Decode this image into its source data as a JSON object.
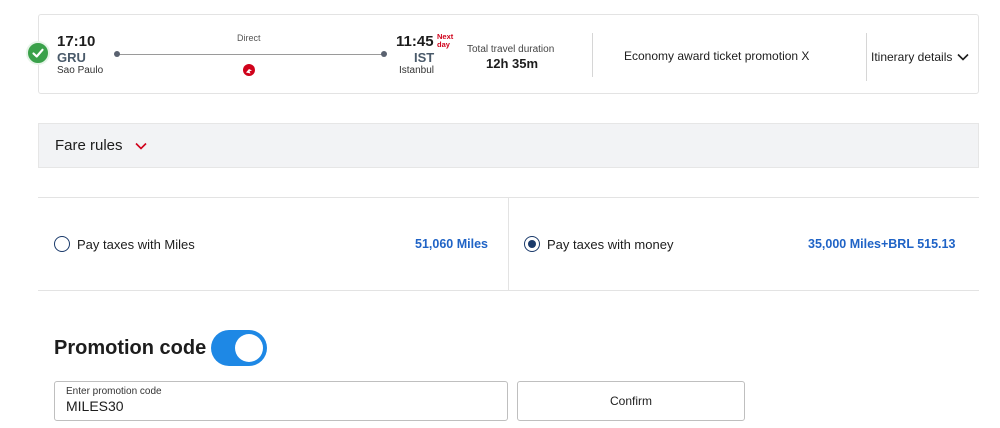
{
  "flight": {
    "departure": {
      "time": "17:10",
      "code": "GRU",
      "city": "Sao Paulo"
    },
    "stops_label": "Direct",
    "arrival": {
      "time": "11:45",
      "next_day": "Next day",
      "code": "IST",
      "city": "Istanbul"
    },
    "duration_label": "Total travel duration",
    "duration_value": "12h 35m",
    "fare_title": "Economy award ticket promotion X",
    "itinerary_button": "Itinerary details"
  },
  "fare_rules": {
    "label": "Fare rules"
  },
  "payment": {
    "options": [
      {
        "label": "Pay taxes with Miles",
        "value": "51,060 Miles",
        "selected": false
      },
      {
        "label": "Pay taxes with money",
        "value": "35,000 Miles+BRL 515.13",
        "selected": true
      }
    ]
  },
  "promotion": {
    "heading": "Promotion code",
    "toggle_on": true,
    "input_label": "Enter promotion code",
    "input_value": "MILES30",
    "confirm_label": "Confirm"
  },
  "colors": {
    "accent_blue": "#1f63c6",
    "toggle_blue": "#1e88e5",
    "brand_red": "#d0021b",
    "check_green": "#3aa14a",
    "radio_navy": "#1a3a6b"
  },
  "icons": {
    "status": "check-circle-icon",
    "airline": "turkish-airlines-logo-icon",
    "expand": "chevron-down-icon"
  }
}
